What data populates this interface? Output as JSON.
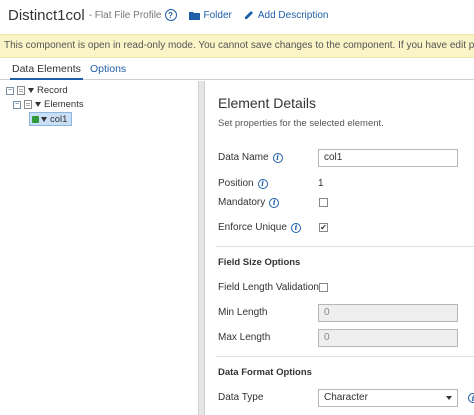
{
  "header": {
    "title": "Distinct1col",
    "subtitle": "- Flat File Profile",
    "help_glyph": "?",
    "folder_label": "Folder",
    "add_description_label": "Add Description"
  },
  "banner": {
    "text": "This component is open in read-only mode. You cannot save changes to the component. If you have edit privileges"
  },
  "tabs": [
    {
      "label": "Data Elements",
      "active": true
    },
    {
      "label": "Options",
      "active": false
    }
  ],
  "tree": {
    "expand_glyph": "−",
    "record_label": "Record",
    "elements_label": "Elements",
    "selected_element": "col1"
  },
  "details": {
    "title": "Element Details",
    "subtitle": "Set properties for the selected element.",
    "info_glyph": "i",
    "data_name_label": "Data Name",
    "data_name_value": "col1",
    "position_label": "Position",
    "position_value": "1",
    "mandatory_label": "Mandatory",
    "mandatory_checked": false,
    "enforce_unique_label": "Enforce Unique",
    "enforce_unique_checked": true,
    "check_glyph": "✔",
    "field_size_heading": "Field Size Options",
    "field_length_validation_label": "Field Length Validation",
    "field_length_validation_checked": false,
    "min_length_label": "Min Length",
    "min_length_value": "0",
    "max_length_label": "Max Length",
    "max_length_value": "0",
    "data_format_heading": "Data Format Options",
    "data_type_label": "Data Type",
    "data_type_value": "Character"
  },
  "colors": {
    "accent": "#1f5fa8",
    "banner_bg": "#fbf4c6",
    "selected_row_bg": "#c9dff5",
    "leaf_icon": "#2f9a3a"
  },
  "icons": {
    "help": "question-circle-icon",
    "folder": "folder-icon",
    "add_description": "pencil-icon",
    "tree_expand": "minus-box-icon",
    "tree_doc": "document-icon",
    "tree_caret": "caret-down-icon",
    "leaf": "element-leaf-icon",
    "info": "info-circle-icon",
    "select_arrow": "chevron-down-icon"
  }
}
